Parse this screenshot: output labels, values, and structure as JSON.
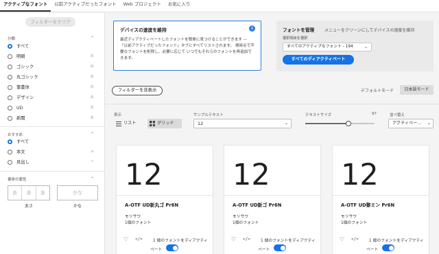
{
  "tabs": [
    {
      "label": "アクティブなフォント"
    },
    {
      "label": "以前アクティブだったフォント"
    },
    {
      "label": "Web プロジェクト"
    },
    {
      "label": "お気に入り"
    }
  ],
  "sidebar": {
    "clear_filters": "フィルターをクリア",
    "category_head": "分類",
    "categories": [
      {
        "label": "すべて",
        "selected": true,
        "icon": ""
      },
      {
        "label": "明朝",
        "selected": false,
        "icon": "あ"
      },
      {
        "label": "ゴシック",
        "selected": false,
        "icon": "あ"
      },
      {
        "label": "丸ゴシック",
        "selected": false,
        "icon": "あ"
      },
      {
        "label": "筆書体",
        "selected": false,
        "icon": "あ"
      },
      {
        "label": "デザイン",
        "selected": false,
        "icon": "あ"
      },
      {
        "label": "UD",
        "selected": false,
        "icon": "あ"
      },
      {
        "label": "新聞",
        "selected": false,
        "icon": "あ"
      }
    ],
    "recommend_head": "おすすめ",
    "recommend": [
      {
        "label": "すべて",
        "selected": true,
        "icon": ""
      },
      {
        "label": "本文",
        "selected": false,
        "icon": "≡"
      },
      {
        "label": "見出し",
        "selected": false,
        "icon": "⊤"
      }
    ],
    "props_head": "書体の属性",
    "weight_cells": [
      "あ",
      "あ",
      "あ"
    ],
    "weight_label": "太さ",
    "kana_cell": "かな",
    "kana_label": "かな"
  },
  "info_card": {
    "title": "デバイスの速度を維持",
    "body": "最近ディアクティベートしたフォントを簡単に見つけることができます — 「以前アクティブだったフォント」タブにすべてリストされます。 現時点で不要なフォントを削除し、必要に応じて いつでもそれらのフォントを再追加できます。",
    "icon": "i"
  },
  "manage": {
    "title": "フォントを管理",
    "hint": "メニューをクリーンにしてデバイスの速度を維持",
    "sub": "選択項目を選択",
    "select_value": "すべてのアクティブなフォント - 194",
    "deactivate_label": "すべてのディアクティベート"
  },
  "toolbar": {
    "hide_filters": "フィルターを非表示",
    "default_mode": "デフォルトモード",
    "japanese_mode": "日本語モード"
  },
  "controls": {
    "view_label": "表示",
    "list_label": "リスト",
    "grid_label": "グリッド",
    "sample_label": "サンプルテキスト",
    "sample_value": "12",
    "size_label": "テキストサイズ",
    "size_value": "97",
    "size_fraction": 0.62,
    "sort_label": "並べ替え",
    "sort_value": "アクティベー..."
  },
  "cards": [
    {
      "sample": "12",
      "name": "A-OTF UD新丸ゴ Pr6N",
      "foundry": "モリサワ",
      "count": "1個のフォント",
      "activate_a": "1 個のフォントをディアクティ",
      "activate_b": "ベート",
      "active": true
    },
    {
      "sample": "12",
      "name": "A-OTF UD新ゴ Pr6N",
      "foundry": "モリサワ",
      "count": "1個のフォント",
      "activate_a": "1 個のフォントをディアクティ",
      "activate_b": "ベート",
      "active": true
    },
    {
      "sample": "12",
      "name": "A-OTF UD黎ミン Pr6N",
      "foundry": "モリサワ",
      "count": "1個のフォント",
      "activate_a": "1 個のフォントをディアクティ",
      "activate_b": "ベート",
      "active": true
    }
  ],
  "colors": {
    "accent": "#1473e6",
    "info_border": "#2d7ddd"
  }
}
